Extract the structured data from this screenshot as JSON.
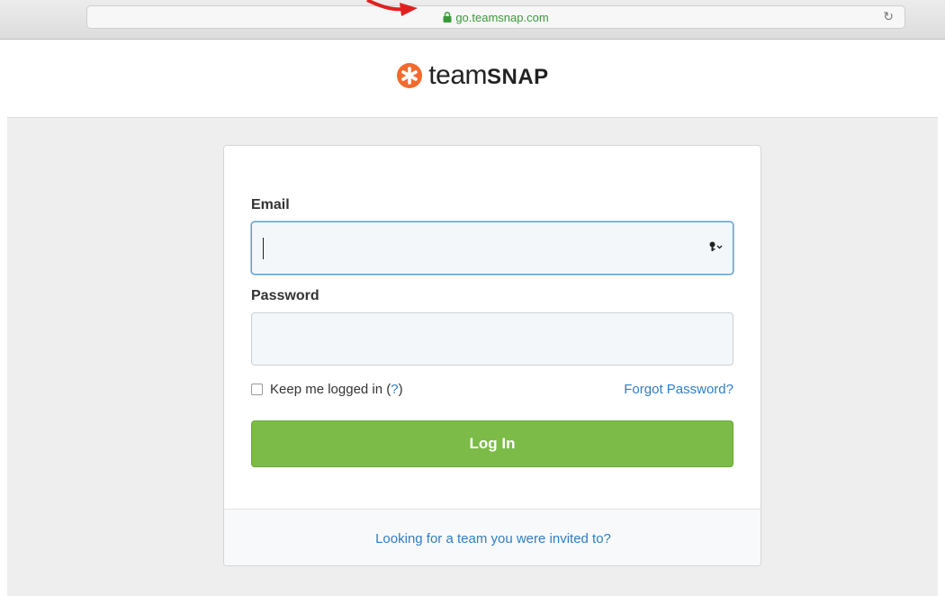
{
  "browser": {
    "url": "go.teamsnap.com",
    "reload_icon": "reload-icon"
  },
  "logo": {
    "icon": "teamsnap-asterisk-icon",
    "text_light": "team",
    "text_bold": "SNAP"
  },
  "form": {
    "email_label": "Email",
    "email_value": "",
    "password_label": "Password",
    "password_value": "",
    "remember_label": "Keep me logged in",
    "remember_help_open": "(",
    "remember_help_q": "?",
    "remember_help_close": ")",
    "remember_checked": false,
    "forgot_label": "Forgot Password?",
    "login_label": "Log In",
    "invite_label": "Looking for a team you were invited to?"
  },
  "colors": {
    "brand_orange": "#f26b2e",
    "login_green": "#7cbb47",
    "link_blue": "#2f7ec4",
    "url_green": "#3a9a3a"
  }
}
